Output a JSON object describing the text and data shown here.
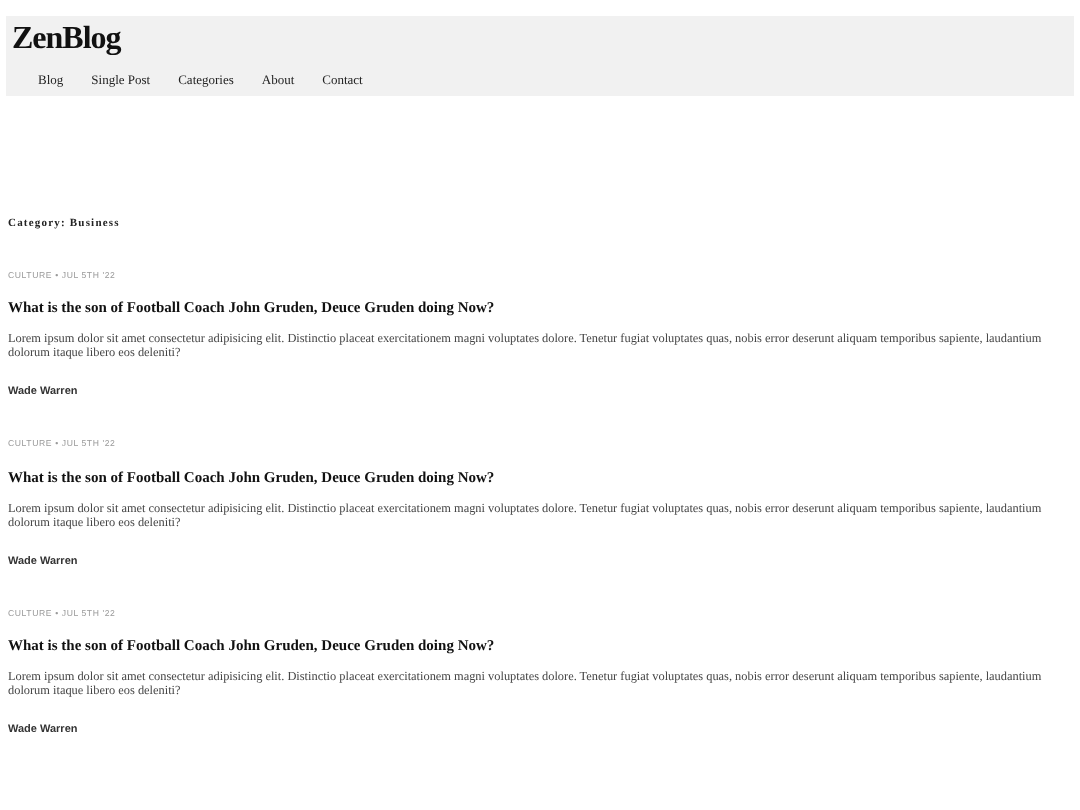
{
  "site": {
    "logo": "ZenBlog",
    "nav": [
      "Blog",
      "Single Post",
      "Categories",
      "About",
      "Contact"
    ]
  },
  "category_heading": "Category: Business",
  "posts": [
    {
      "meta": "CULTURE • JUL 5TH '22",
      "title": "What is the son of Football Coach John Gruden, Deuce Gruden doing Now?",
      "excerpt": "Lorem ipsum dolor sit amet consectetur adipisicing elit. Distinctio placeat exercitationem magni voluptates dolore. Tenetur fugiat voluptates quas, nobis error deserunt aliquam temporibus sapiente, laudantium dolorum itaque libero eos deleniti?",
      "author": "Wade Warren"
    },
    {
      "meta": "CULTURE • JUL 5TH '22",
      "title": "What is the son of Football Coach John Gruden, Deuce Gruden doing Now?",
      "excerpt": "Lorem ipsum dolor sit amet consectetur adipisicing elit. Distinctio placeat exercitationem magni voluptates dolore. Tenetur fugiat voluptates quas, nobis error deserunt aliquam temporibus sapiente, laudantium dolorum itaque libero eos deleniti?",
      "author": "Wade Warren"
    },
    {
      "meta": "CULTURE • JUL 5TH '22",
      "title": "What is the son of Football Coach John Gruden, Deuce Gruden doing Now?",
      "excerpt": "Lorem ipsum dolor sit amet consectetur adipisicing elit. Distinctio placeat exercitationem magni voluptates dolore. Tenetur fugiat voluptates quas, nobis error deserunt aliquam temporibus sapiente, laudantium dolorum itaque libero eos deleniti?",
      "author": "Wade Warren"
    }
  ]
}
